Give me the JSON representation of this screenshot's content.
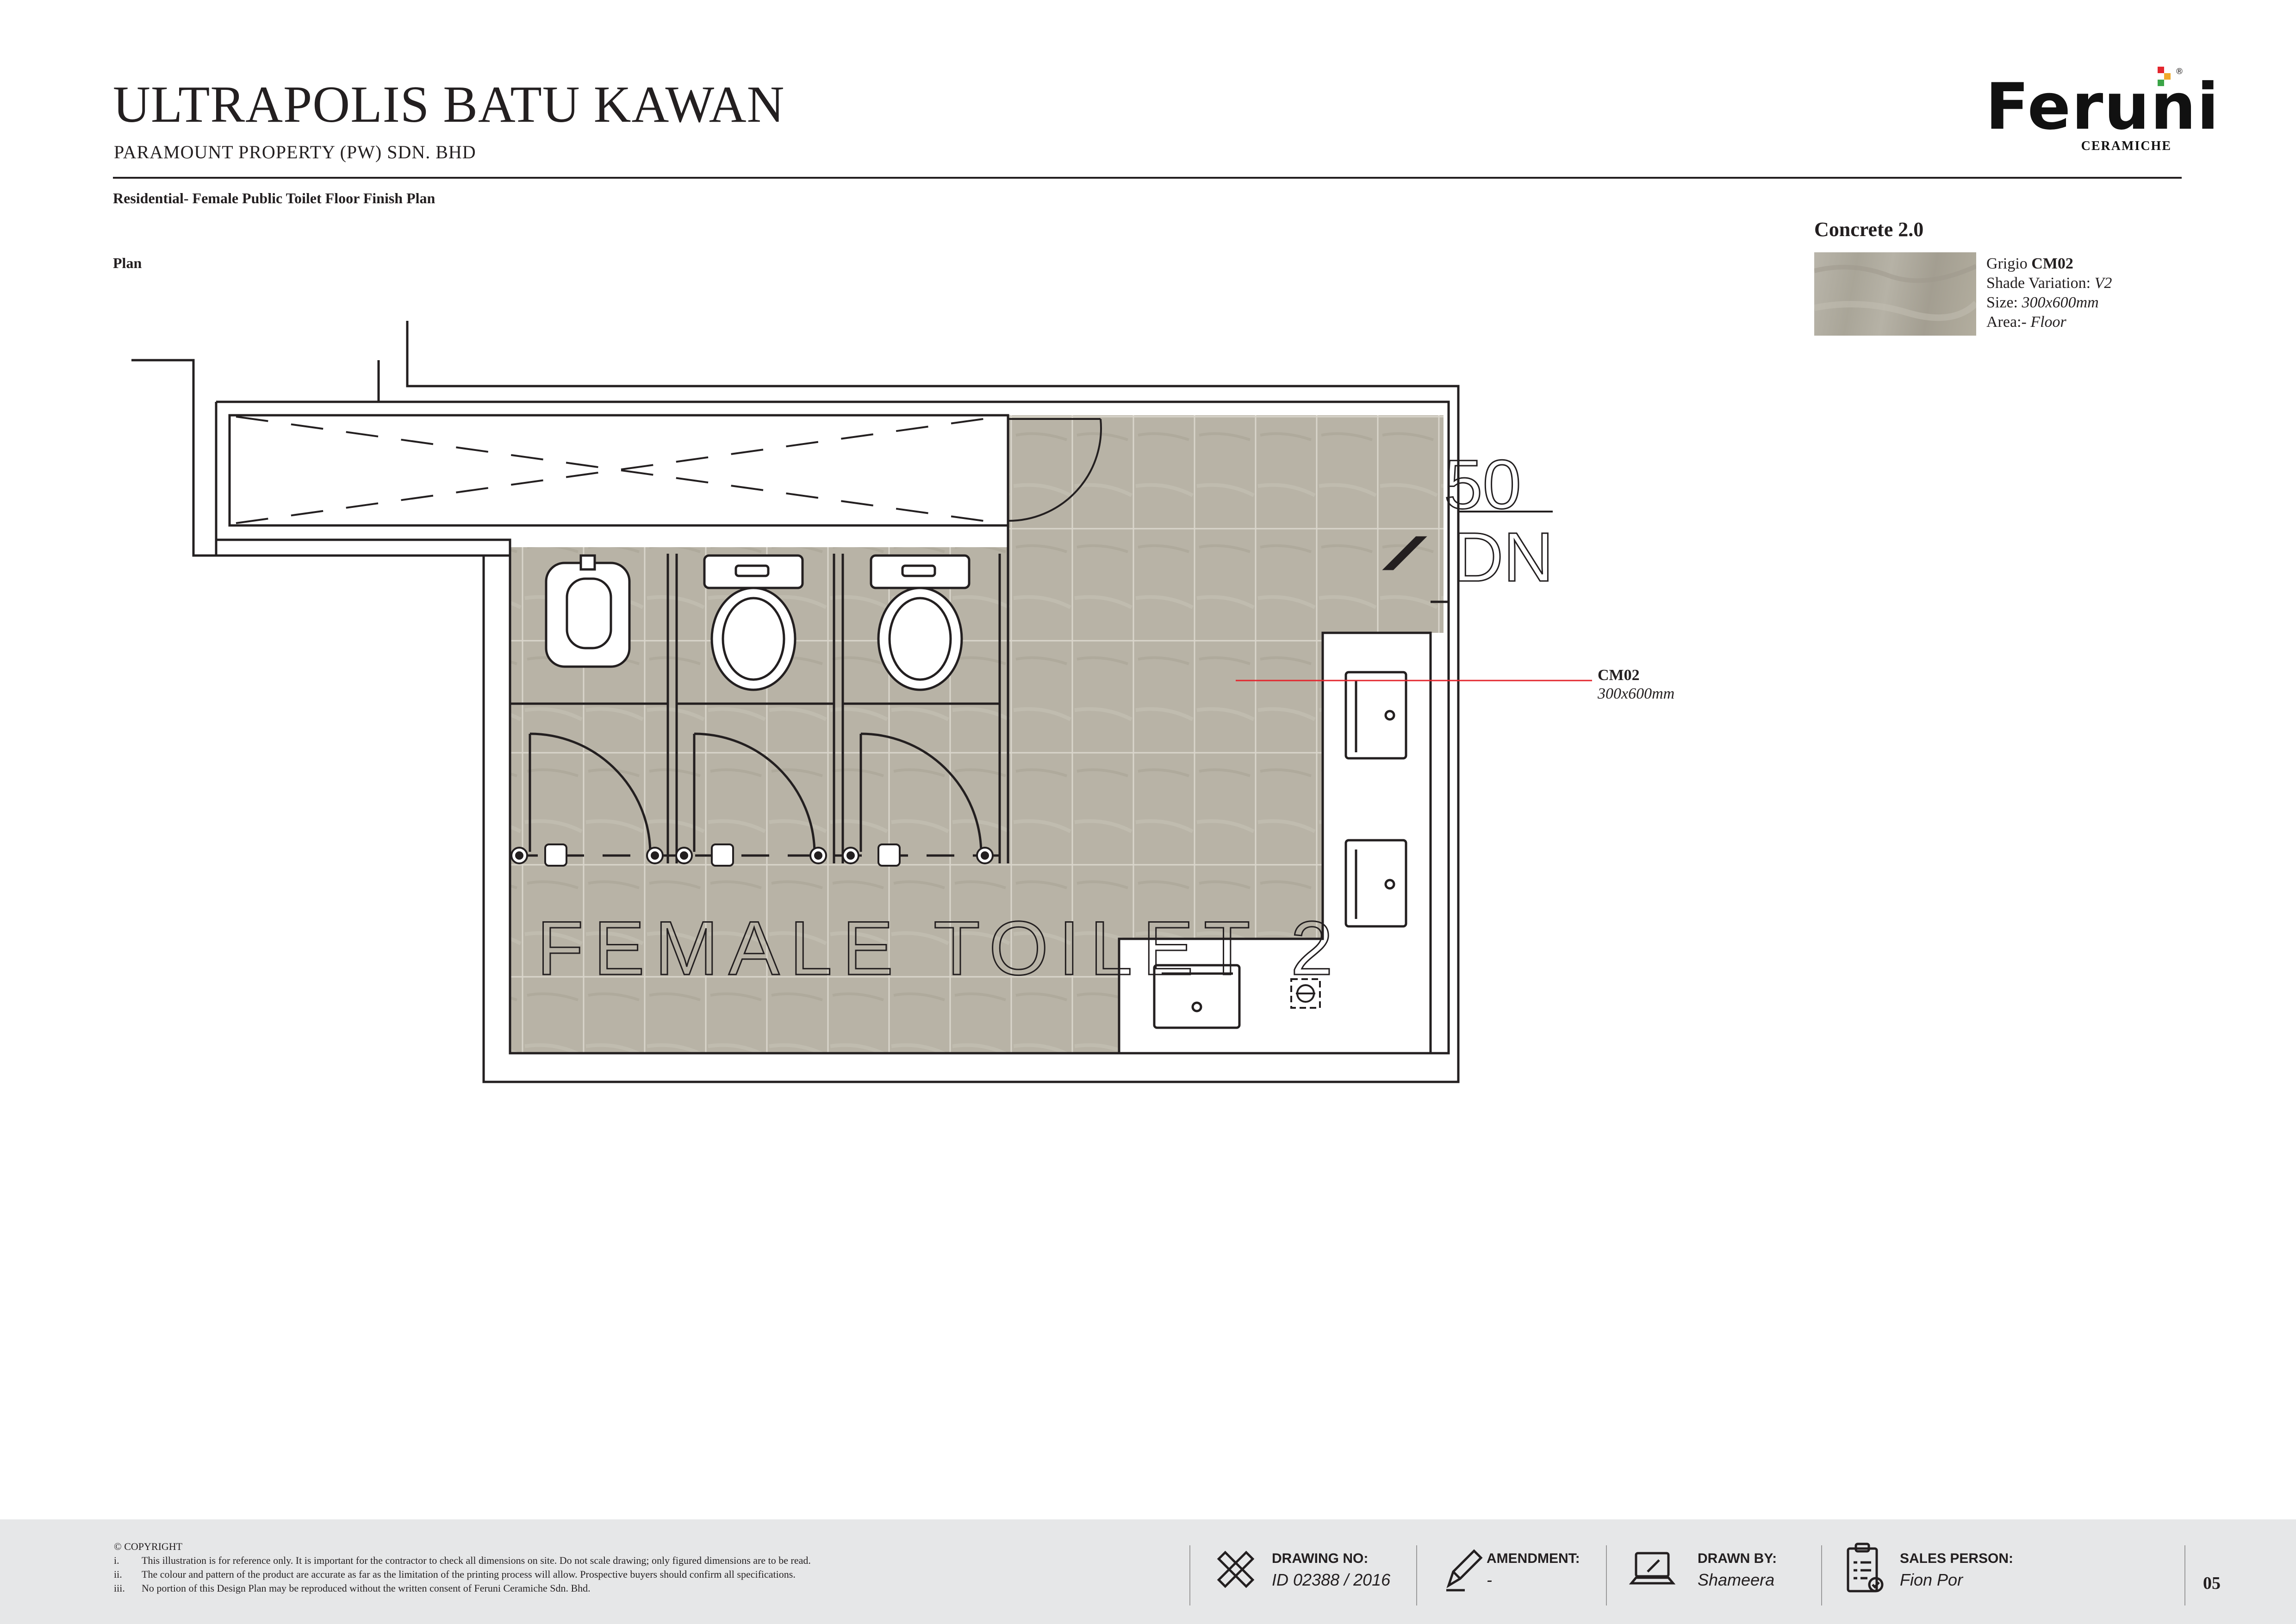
{
  "header": {
    "project_title": "ULTRAPOLIS BATU KAWAN",
    "client": "PARAMOUNT PROPERTY (PW) SDN. BHD",
    "section_title": "Residential-  Female Public Toilet Floor Finish Plan",
    "view_label": "Plan"
  },
  "logo": {
    "word": "Feruni",
    "sub": "CERAMICHE",
    "registered": "®",
    "colors": [
      "#e3262e",
      "#f0a92a",
      "#3aa447"
    ]
  },
  "material": {
    "collection": "Concrete 2.0",
    "color_name": "Grigio ",
    "code": "CM02",
    "shade_label": "Shade Variation: ",
    "shade_value": "V2",
    "size_label": "Size: ",
    "size_value": "300x600mm",
    "area_label": "Area:- ",
    "area_value": "Floor"
  },
  "plan": {
    "room_label": "FEMALE TOILET 2",
    "level_value": "50",
    "stair_label": "DN",
    "callout_code": "CM02",
    "callout_size": "300x600mm",
    "tile_color": "#b8b3a6",
    "callout_color": "#e3262e"
  },
  "footer": {
    "copyright": "© COPYRIGHT",
    "notes": [
      {
        "num": "i.",
        "text": "This illustration is for reference only. It is important for the contractor to check all dimensions on site. Do not scale drawing; only figured dimensions are to be read."
      },
      {
        "num": "ii.",
        "text": "The colour and pattern of the product are accurate as far as the limitation of the printing process will allow. Prospective buyers should confirm all specifications."
      },
      {
        "num": "iii.",
        "text": "No portion of this Design Plan may be reproduced without the written consent of Feruni Ceramiche Sdn. Bhd."
      }
    ],
    "drawing_no_label": "DRAWING NO:",
    "drawing_no": "ID 02388 / 2016",
    "amendment_label": "AMENDMENT:",
    "amendment": "-",
    "drawn_by_label": "DRAWN BY:",
    "drawn_by": "Shameera",
    "sales_label": "SALES PERSON:",
    "sales_person": "Fion Por",
    "page_number": "05",
    "icons": [
      "ruler-pencil-icon",
      "pen-icon",
      "laptop-icon",
      "clipboard-icon"
    ]
  }
}
